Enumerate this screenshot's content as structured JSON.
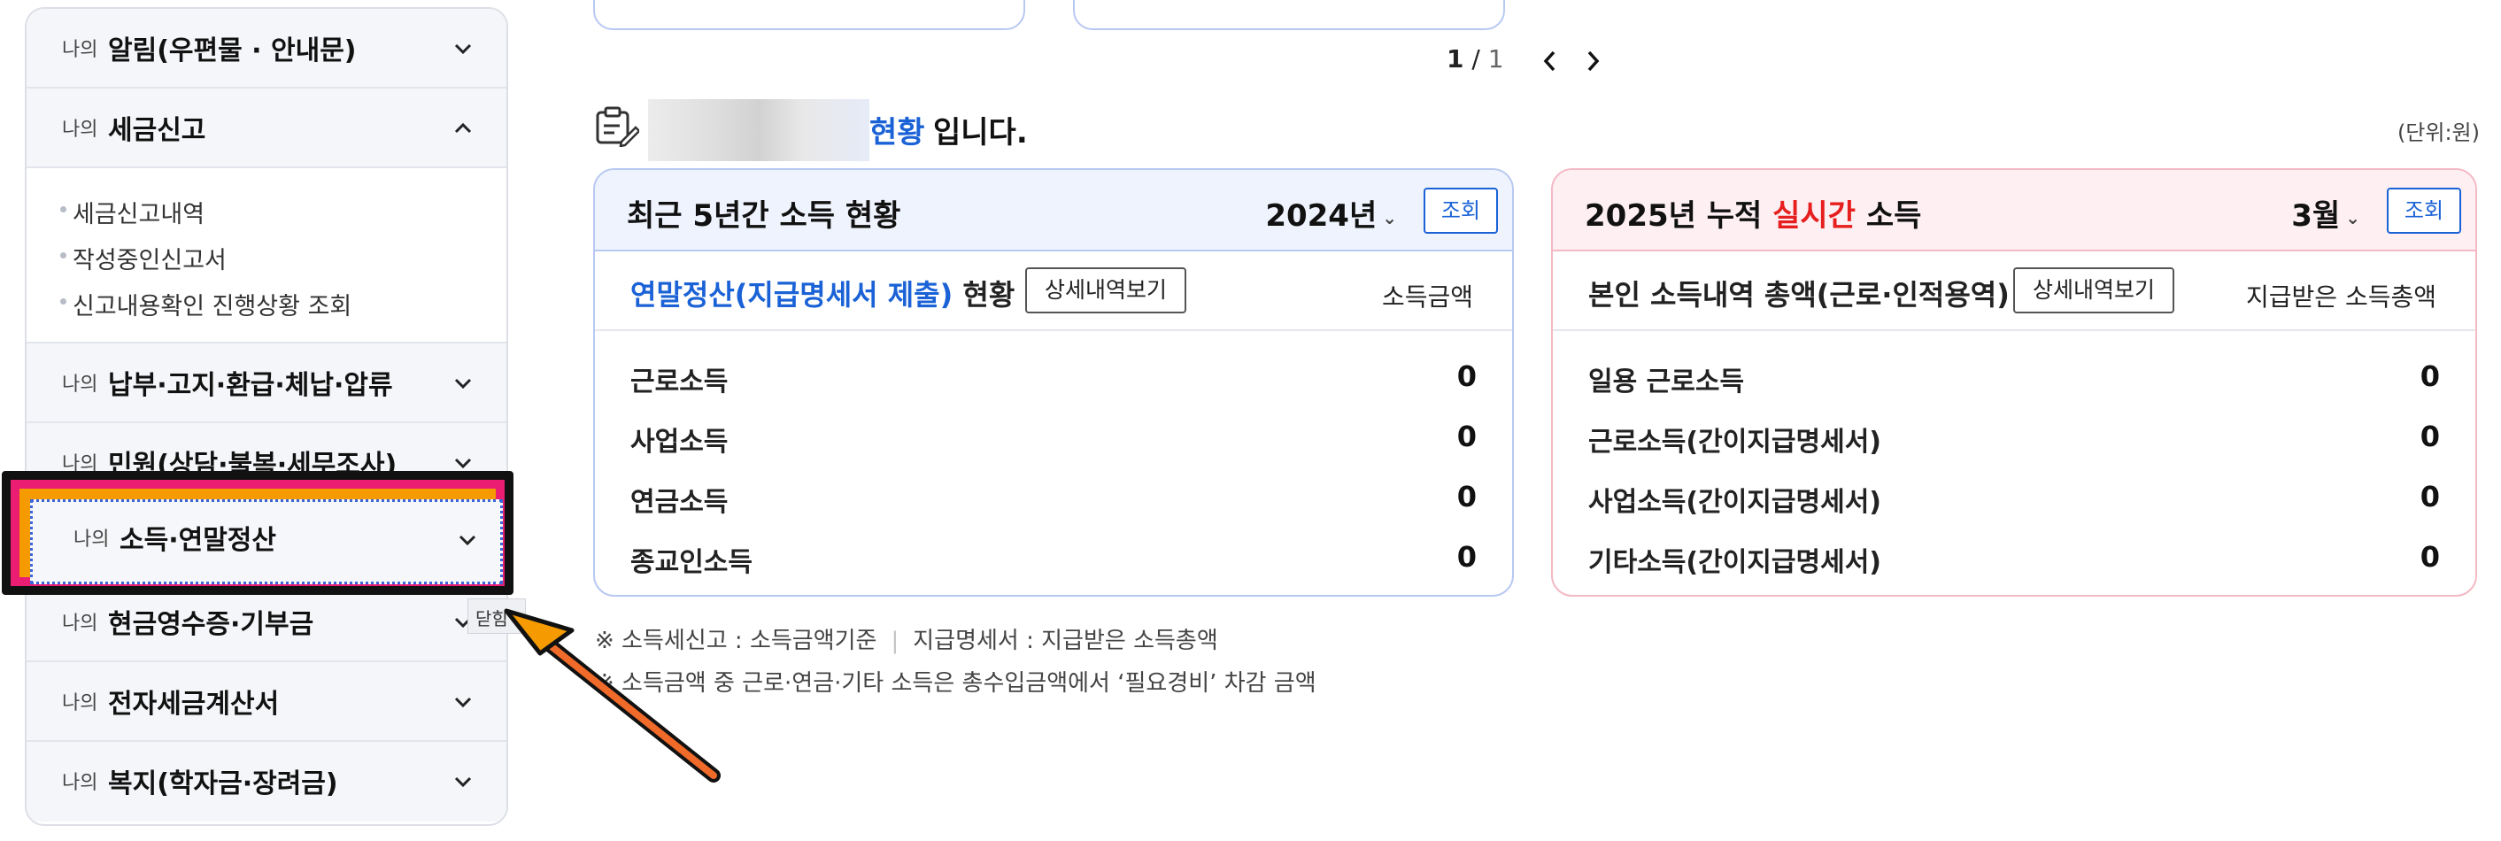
{
  "sidebar": {
    "prefix": "나의",
    "items": [
      {
        "title": "알림(우편물 · 안내문)",
        "state": "collapsed"
      },
      {
        "title": "세금신고",
        "state": "expanded"
      },
      {
        "title": "납부·고지·환급·체납·압류",
        "state": "collapsed"
      },
      {
        "title": "민원(상담·불복·세무조사)",
        "state": "collapsed"
      },
      {
        "title": "소득·연말정산",
        "state": "focused"
      },
      {
        "title": "현금영수증·기부금",
        "state": "collapsed"
      },
      {
        "title": "전자세금계산서",
        "state": "collapsed"
      },
      {
        "title": "복지(학자금·장려금)",
        "state": "collapsed"
      }
    ],
    "sub_items": [
      "세금신고내역",
      "작성중인신고서",
      "신고내용확인 진행상황 조회"
    ],
    "tooltip": "닫힘"
  },
  "pager": {
    "current": "1",
    "separator": "/",
    "total": "1"
  },
  "status": {
    "highlight": "현황",
    "rest": "입니다.",
    "unit": "(단위:원)"
  },
  "left_panel": {
    "title": "최근 5년간 소득 현황",
    "year": "2024년",
    "query_btn": "조회",
    "sub_label_blue": "연말정산(지급명세서 제출)",
    "sub_label_rest": " 현황",
    "detail_btn": "상세내역보기",
    "column": "소득금액",
    "rows": [
      {
        "name": "근로소득",
        "value": "0"
      },
      {
        "name": "사업소득",
        "value": "0"
      },
      {
        "name": "연금소득",
        "value": "0"
      },
      {
        "name": "종교인소득",
        "value": "0"
      }
    ]
  },
  "right_panel": {
    "title_prefix": "2025년 누적 ",
    "title_red": "실시간",
    "title_suffix": " 소득",
    "month": "3월",
    "query_btn": "조회",
    "sub_label": "본인 소득내역 총액(근로·인적용역)",
    "detail_btn": "상세내역보기",
    "column": "지급받은 소득총액",
    "rows": [
      {
        "name": "일용 근로소득",
        "value": "0"
      },
      {
        "name": "근로소득(간이지급명세서)",
        "value": "0"
      },
      {
        "name": "사업소득(간이지급명세서)",
        "value": "0"
      },
      {
        "name": "기타소득(간이지급명세서)",
        "value": "0"
      }
    ]
  },
  "notes": {
    "line1_a": "※ 소득세신고 : 소득금액기준",
    "line1_b": "지급명세서 : 지급받은 소득총액",
    "line2": "※ 소득금액 중 근로·연금·기타 소득은 총수입금액에서 ‘필요경비’ 차감 금액"
  },
  "colors": {
    "accent": "#1a62d6",
    "highlight_red": "#e61e1e",
    "focus_pink": "#ea1d73",
    "focus_orange": "#f59a00"
  }
}
